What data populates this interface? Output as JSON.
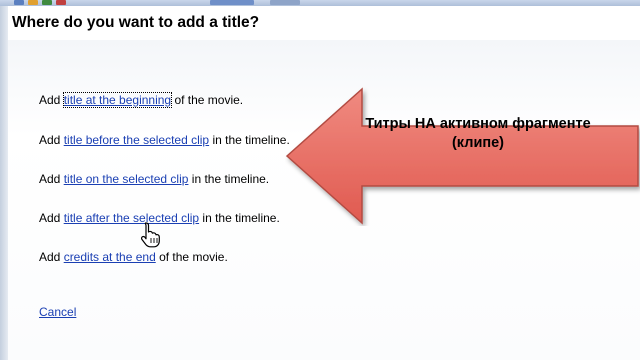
{
  "window": {
    "title": "Where do you want to add a title?"
  },
  "options": [
    {
      "prefix": "Add ",
      "link": "title at the beginning",
      "suffix": " of the movie."
    },
    {
      "prefix": "Add ",
      "link": "title before the selected clip",
      "suffix": " in the timeline."
    },
    {
      "prefix": "Add ",
      "link": "title on the selected clip",
      "suffix": " in the timeline."
    },
    {
      "prefix": "Add ",
      "link": "title after the selected clip",
      "suffix": " in the timeline."
    },
    {
      "prefix": "Add ",
      "link": "credits at the end",
      "suffix": " of the movie."
    }
  ],
  "cancel": {
    "label": "Cancel"
  },
  "callout": {
    "line1": "Титры НА активном фрагменте",
    "line2": "(клипе)",
    "color": "#e8675c"
  },
  "colors": {
    "link": "#1a3fb3",
    "callout_fill": "#e8675c",
    "callout_border": "#b24b42"
  },
  "cursor": {
    "icon": "hand-pointer-icon"
  }
}
